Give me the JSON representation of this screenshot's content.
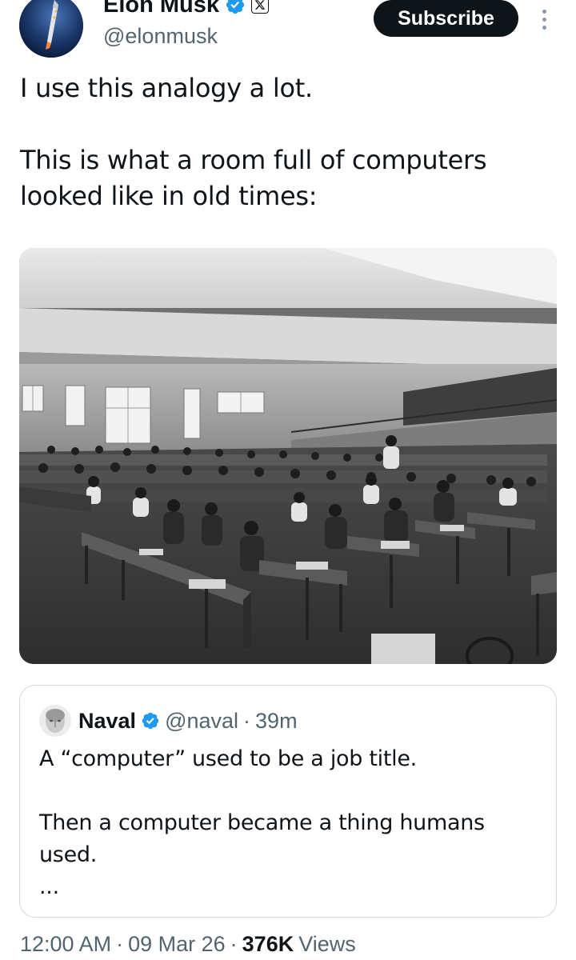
{
  "author": {
    "name": "Elon Musk",
    "handle": "@elonmusk",
    "verified": true,
    "affiliate_badge": "x-logo-icon"
  },
  "actions": {
    "subscribe_label": "Subscribe",
    "more_icon": "more-vertical-icon"
  },
  "tweet": {
    "lines": [
      "I use this analogy a lot.",
      "This is what a room full of computers looked like in old times:"
    ]
  },
  "photo": {
    "icon": "photo-image",
    "tone": "black-and-white"
  },
  "quote": {
    "author": "Naval",
    "handle": "@naval",
    "separator": "·",
    "time": "39m",
    "verified": true,
    "lines": [
      "A “computer” used to be a job title.",
      "Then a computer became a thing humans used.",
      "..."
    ]
  },
  "meta": {
    "time": "12:00 AM",
    "sep1": "·",
    "date": "09 Mar 26",
    "sep2": "·",
    "views_count": "376K",
    "views_label": "Views"
  },
  "colors": {
    "text_primary": "#0f1419",
    "text_secondary": "#536471",
    "verified_blue": "#1d9bf0",
    "border": "#cfd9de",
    "button_bg": "#0f1419"
  }
}
